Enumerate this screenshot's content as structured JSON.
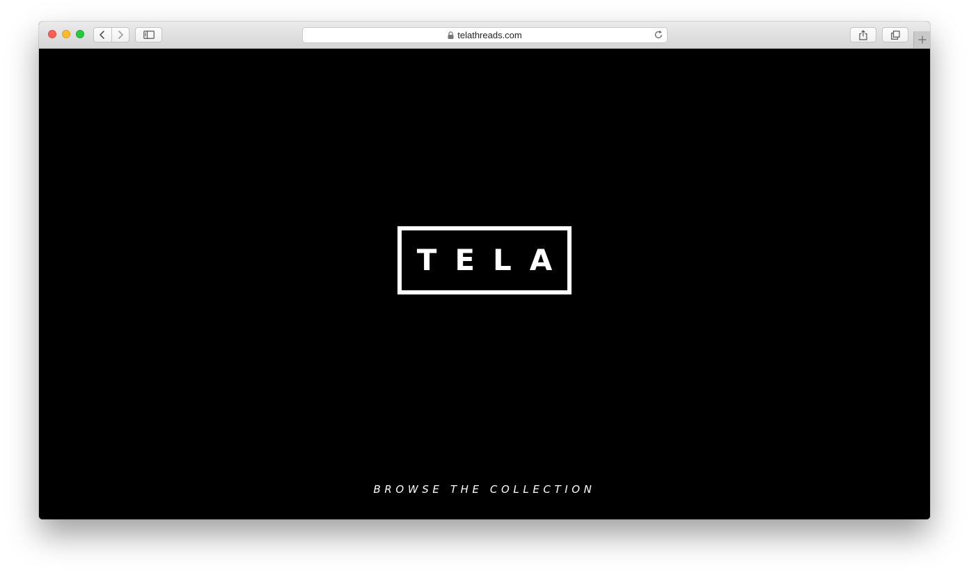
{
  "browser": {
    "url": "telathreads.com",
    "secure": true
  },
  "page": {
    "logo_text": "TELA",
    "cta_label": "BROWSE THE COLLECTION"
  },
  "colors": {
    "page_background": "#000000",
    "logo_color": "#ffffff",
    "cta_color": "#ffffff"
  },
  "icons": {
    "close": "close-window-icon",
    "minimize": "minimize-window-icon",
    "maximize": "maximize-window-icon",
    "back": "chevron-left-icon",
    "forward": "chevron-right-icon",
    "sidebar": "sidebar-icon",
    "lock": "lock-icon",
    "reload": "reload-icon",
    "share": "share-icon",
    "tabs": "tab-overview-icon",
    "new_tab": "plus-icon"
  }
}
